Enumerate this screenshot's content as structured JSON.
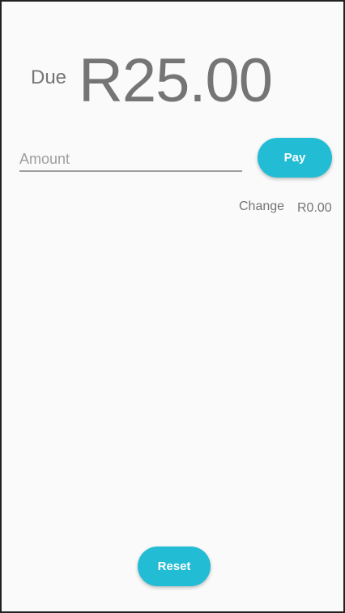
{
  "due": {
    "label": "Due",
    "amount": "R25.00"
  },
  "amount_input": {
    "placeholder": "Amount",
    "value": ""
  },
  "pay_button": "Pay",
  "change": {
    "label": "Change",
    "value": "R0.00"
  },
  "reset_button": "Reset",
  "colors": {
    "accent": "#22bcd4"
  }
}
